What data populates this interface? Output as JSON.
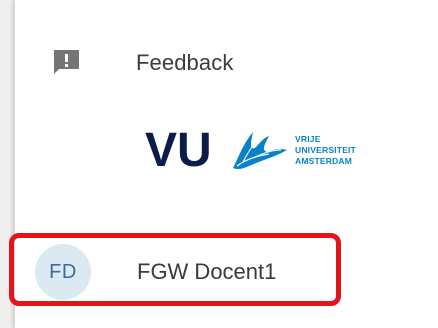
{
  "menu": {
    "feedback": {
      "label": "Feedback",
      "icon": "feedback-icon"
    },
    "logo": {
      "mark": "VU",
      "line1": "VRIJE",
      "line2": "UNIVERSITEIT",
      "line3": "AMSTERDAM"
    },
    "user": {
      "initials": "FD",
      "name": "FGW Docent1"
    }
  },
  "colors": {
    "highlight": "#e4141b",
    "logo_navy": "#0b1c48",
    "logo_blue": "#0a82c8",
    "avatar_bg": "#dbe9f3"
  }
}
